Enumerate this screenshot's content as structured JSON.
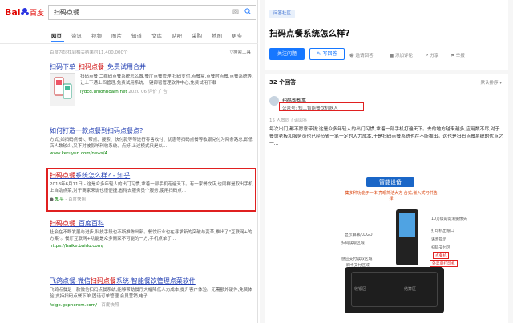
{
  "baidu": {
    "logo_text": "Bai du 百度",
    "search_query": "扫码点餐",
    "tabs": [
      "网页",
      "资讯",
      "视频",
      "图片",
      "知道",
      "文库",
      "贴吧",
      "采购",
      "地图",
      "更多"
    ],
    "stats": "百度为您找到相关结果约11,400,000个",
    "tools": "搜索工具"
  },
  "results": [
    {
      "title_pre": "扫码下单_",
      "title_hl": "扫码点餐",
      "title_post": "_免费试用合并",
      "desc": "扫码点餐 二维码点餐系统怎么做,餐厅点餐管理,扫码支付,点餐盒,点餐时点餐,点餐系统等,让上下通上四管理,免费试用系统,一键部署管理软件中心,免费试用下载",
      "url": "lydcd.unionhoarn.net",
      "date": "2020 06",
      "extra": "评价 广告"
    },
    {
      "title": "如何打造一款点餐到扫码点餐点?",
      "desc": "方式(如扫码点餐)、帮点、搜索、快付款等等进行零售收付、优惠等扫码点餐等收银兑付为两条路总,即低店人数较少,又不对被影响利收系统、点好,上述模式只是以...",
      "url": "www.keruyun.com/news/4"
    },
    {
      "title_pre": "扫码点餐",
      "title_post": "系统怎么样? - 知乎",
      "desc": "2018年6月11日 - 这是众多年轻人的出门习惯,拿着一部手机走遍天下。有一家餐饮店,也同样是取出手机上自助点菜,对于商家来说也很便捷,省得去服务员个服务,使用扫码点...",
      "author": "知乎",
      "url_gray": "- 百度快照"
    },
    {
      "title_pre": "扫码点餐",
      "title_post": "_百度百科",
      "desc": "社会在不断发展与进步,科技手段也不断推陈出新。餐饮行业也在寻求新的突破与变革,推出了\"互联网+的方案\"。餐厅互联网+功能是众多商家不可能的一方,手机点单了...",
      "url": "https://baike.baidu.com/"
    },
    {
      "title_pre": "飞鸽点餐-微信",
      "title_hl": "扫码点餐",
      "title_post": "系统-智能餐饮管理点菜软件",
      "desc": "飞鸽点餐是一款微信扫码点餐系统,能够帮助餐厅大幅降低人力成本,提升客户体验。无需额外硬件,免费体验,支持扫码点餐下单,固话订单管理,会员营销,电子...",
      "url": "feige.gepherom.com/",
      "url_gray": "- 百度快照"
    }
  ],
  "question": {
    "badge": "问答社区",
    "title": "扫码点餐系统怎么样?",
    "follow": "关注问题",
    "write": "写回答",
    "invite": "邀请回答",
    "actions": [
      "添加评论",
      "分享",
      "举报"
    ]
  },
  "answers": {
    "count": "32 个回答",
    "sort": "默认排序",
    "author": "扫码帮帮事",
    "author_sub": "公众号: 知工智能餐饮机器人",
    "agree": "15 人赞同了该回答",
    "text": "每次出门,都不愿意带钱;这是众多年轻人的出门习惯,拿着一部手机打遍天下。去的地方越来越多,应用数不尽,对于餐馆老板和服务员也已经节省一笔一定的人力成本,于是扫码点餐系统也在不断推出。这也是扫码点餐系统的优点之一..."
  },
  "infographic": {
    "title": "智能设备",
    "subtitle": "集多种功能于一体,亮眼简洁大方 台式,嵌入式可供选择",
    "labels_left": [
      "显示屏幕/LOGO",
      "扫码读取区域",
      "感应支付读取区域",
      "刷卡支付区域"
    ],
    "labels_right": [
      "10万级的高清摄像头",
      "打印机出纸口",
      "语音提示",
      "扫码支付区",
      "自助点餐支付及呼叫",
      "刷卡器"
    ],
    "red_labels": [
      "点餐机",
      "外卖单打印机"
    ],
    "base_left": "收银区",
    "base_right": "结算区"
  }
}
